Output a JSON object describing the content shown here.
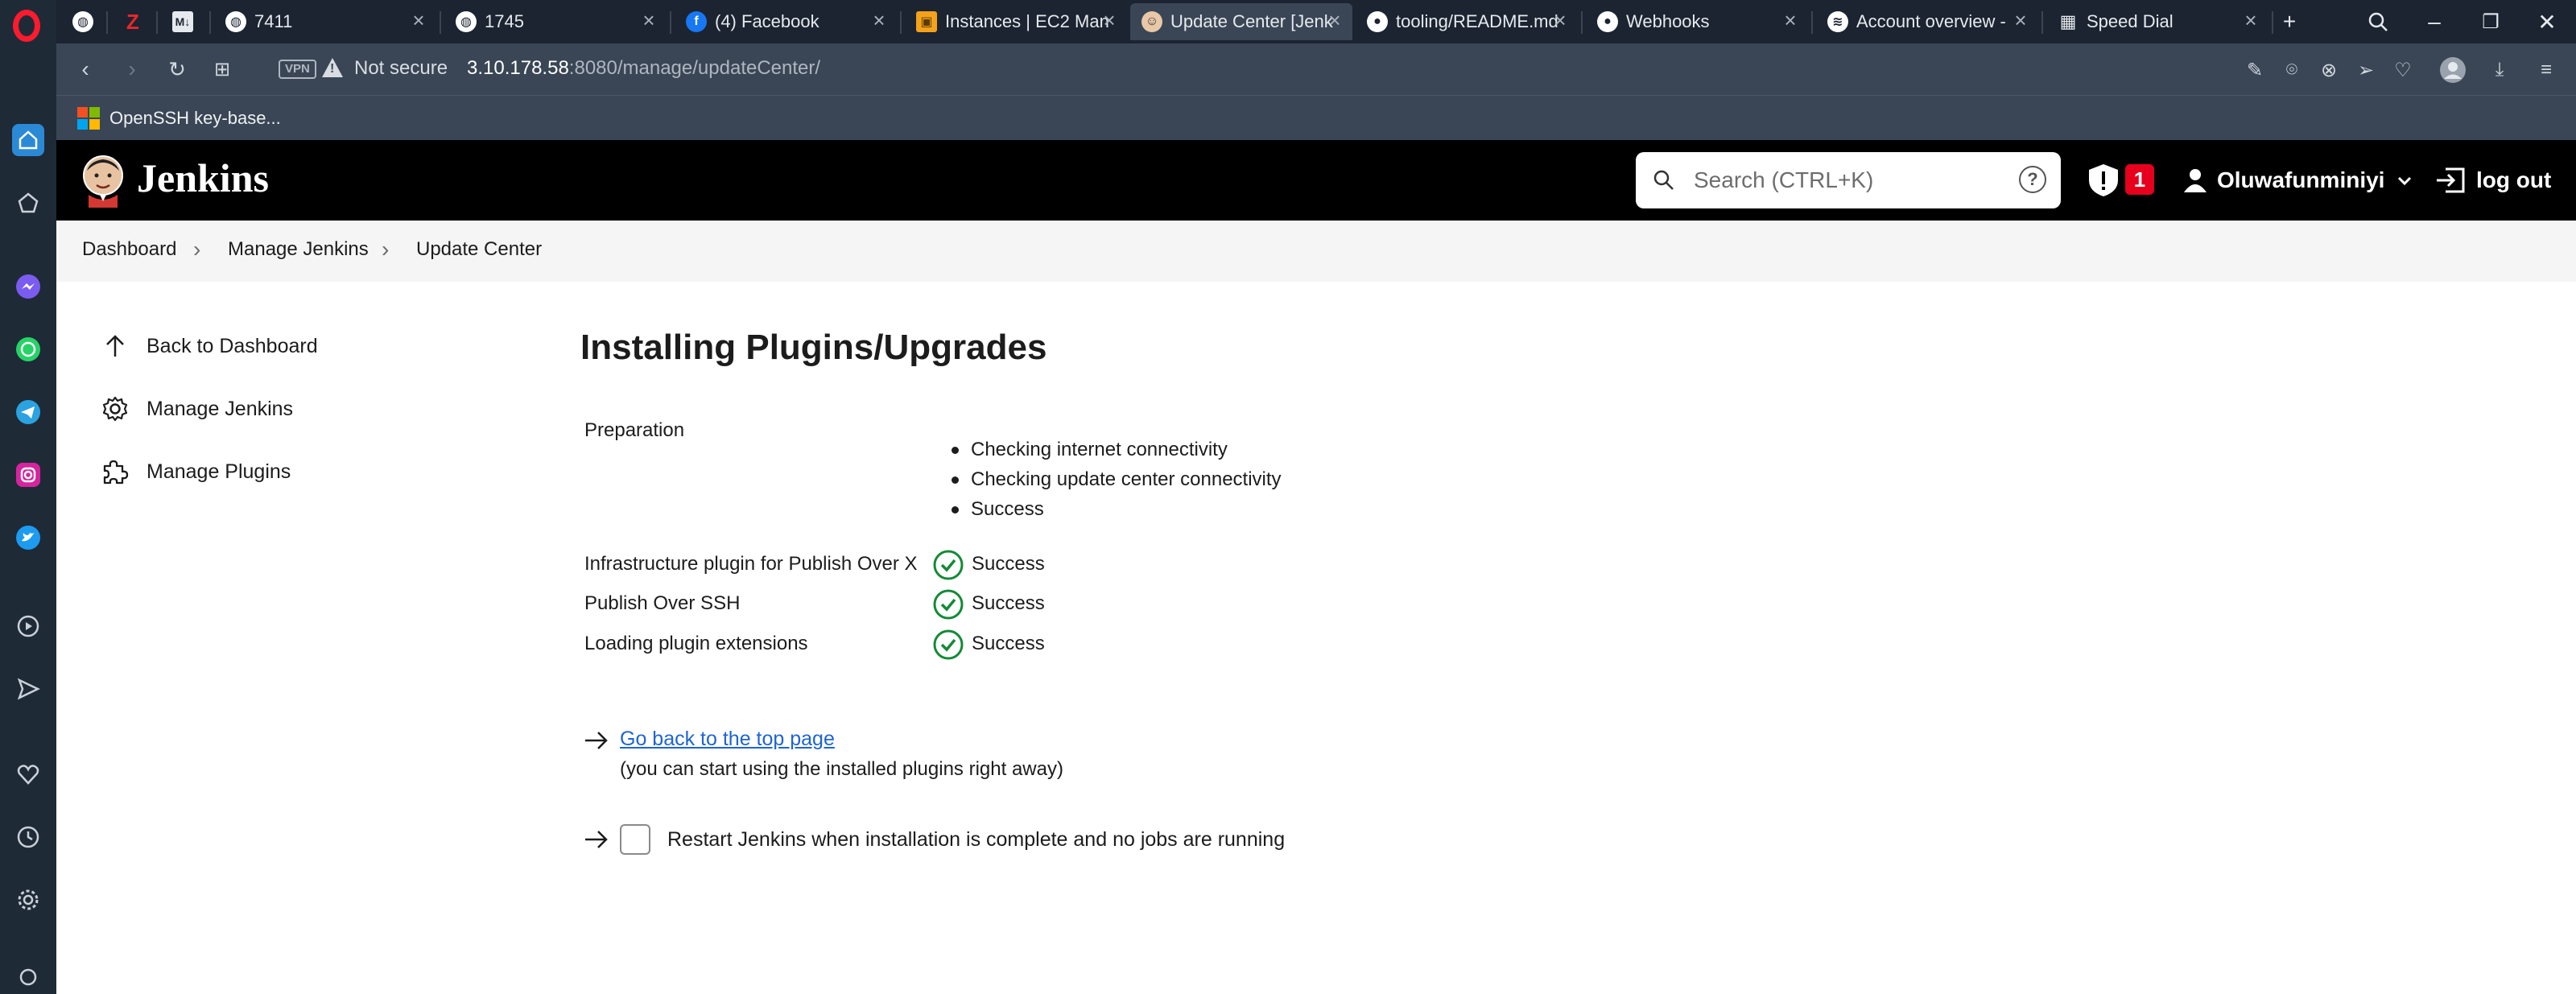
{
  "browser": {
    "tabs": [
      {
        "title": "",
        "icon": "globe-icon"
      },
      {
        "title": "",
        "icon": "z-icon"
      },
      {
        "title": "",
        "icon": "m-icon"
      },
      {
        "title": "7411",
        "icon": "globe-icon"
      },
      {
        "title": "1745",
        "icon": "globe-icon"
      },
      {
        "title": "(4) Facebook",
        "icon": "facebook-icon"
      },
      {
        "title": "Instances | EC2 Man",
        "icon": "aws-icon"
      },
      {
        "title": "Update Center [Jenk",
        "icon": "jenkins-icon",
        "active": true
      },
      {
        "title": "tooling/README.md",
        "icon": "github-icon"
      },
      {
        "title": "Webhooks",
        "icon": "github-icon"
      },
      {
        "title": "Account overview - ",
        "icon": "spotify-icon"
      },
      {
        "title": "Speed Dial",
        "icon": "speed-dial-icon"
      }
    ],
    "vpn_label": "VPN",
    "security_label": "Not secure",
    "url_host": "3.10.178.58",
    "url_rest": ":8080/manage/updateCenter/",
    "bookmark": "OpenSSH key-base..."
  },
  "jenkins": {
    "brand": "Jenkins",
    "search_placeholder": "Search (CTRL+K)",
    "help_glyph": "?",
    "alert_count": "1",
    "username": "Oluwafunminiyi",
    "logout_label": "log out"
  },
  "breadcrumb": [
    "Dashboard",
    "Manage Jenkins",
    "Update Center"
  ],
  "sidebar": {
    "items": [
      {
        "label": "Back to Dashboard",
        "icon": "arrow-up-icon"
      },
      {
        "label": "Manage Jenkins",
        "icon": "gear-icon"
      },
      {
        "label": "Manage Plugins",
        "icon": "puzzle-icon"
      }
    ]
  },
  "main": {
    "title": "Installing Plugins/Upgrades",
    "preparation_label": "Preparation",
    "preparation_steps": [
      "Checking internet connectivity",
      "Checking update center connectivity",
      "Success"
    ],
    "jobs": [
      {
        "name": "Infrastructure plugin for Publish Over X",
        "status": "Success"
      },
      {
        "name": "Publish Over SSH",
        "status": "Success"
      },
      {
        "name": "Loading plugin extensions",
        "status": "Success"
      }
    ],
    "top_link": "Go back to the top page",
    "top_note": "(you can start using the installed plugins right away)",
    "restart_label": "Restart Jenkins when installation is complete and no jobs are running",
    "restart_checked": false
  },
  "colors": {
    "accent_link": "#1e64d2",
    "success": "#138a36",
    "alert": "#e6001e"
  }
}
